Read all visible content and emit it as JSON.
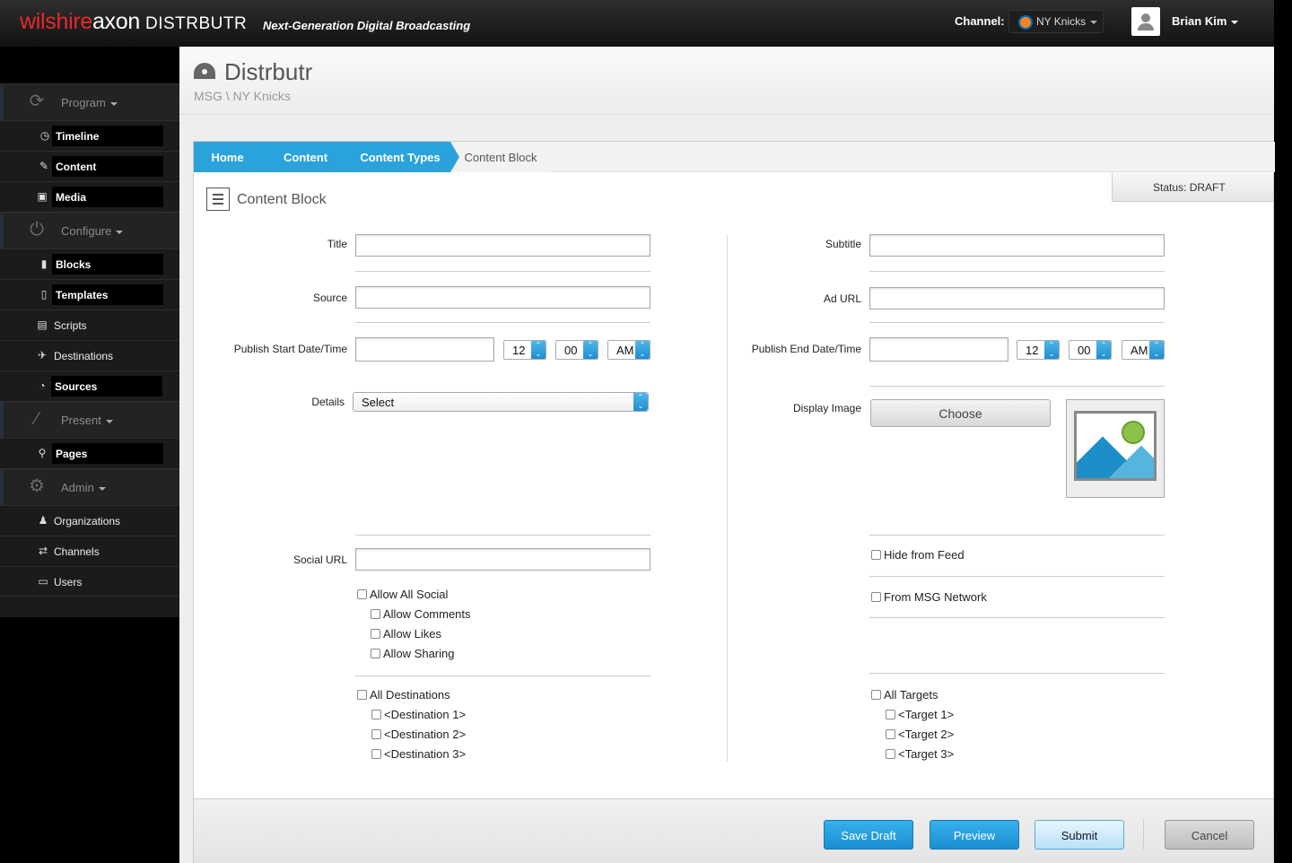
{
  "topbar": {
    "logo_part1": "wilshire",
    "logo_part2": "axon",
    "logo_part3": "DISTRBUTR",
    "tagline": "Next-Generation Digital Broadcasting",
    "channel_label": "Channel:",
    "channel_value": "NY Knicks",
    "user_name": "Brian Kim",
    "colors": {
      "logo_red": "#e8282e",
      "accent_blue": "#2aa3dd"
    }
  },
  "sidebar": {
    "program": {
      "label": "Program",
      "icon": "refresh-icon",
      "items": [
        {
          "label": "Timeline",
          "icon": "clock-icon"
        },
        {
          "label": "Content",
          "icon": "pencil-icon"
        },
        {
          "label": "Media",
          "icon": "picture-icon"
        }
      ]
    },
    "configure": {
      "label": "Configure",
      "icon": "power-icon",
      "items": [
        {
          "label": "Blocks",
          "icon": "bookmark-icon"
        },
        {
          "label": "Templates",
          "icon": "bookmark-outline-icon"
        },
        {
          "label": "Scripts",
          "icon": "script-icon"
        },
        {
          "label": "Destinations",
          "icon": "plane-icon"
        },
        {
          "label": "Sources",
          "icon": "rss-icon"
        }
      ]
    },
    "present": {
      "label": "Present",
      "icon": "magic-wand-icon",
      "items": [
        {
          "label": "Pages",
          "icon": "sitemap-icon"
        }
      ]
    },
    "admin": {
      "label": "Admin",
      "icon": "gear-icon",
      "items": [
        {
          "label": "Organizations",
          "icon": "group-icon"
        },
        {
          "label": "Channels",
          "icon": "exchange-icon"
        },
        {
          "label": "Users",
          "icon": "briefcase-icon"
        }
      ]
    }
  },
  "header": {
    "title": "Distrbutr",
    "subtitle": "MSG \\ NY Knicks"
  },
  "breadcrumbs": [
    "Home",
    "Content",
    "Content Types",
    "Content Block"
  ],
  "status": "Status: DRAFT",
  "block_title": "Content Block",
  "form": {
    "left": {
      "title_label": "Title",
      "source_label": "Source",
      "publish_start_label": "Publish Start Date/Time",
      "start_hour": "12",
      "start_minute": "00",
      "start_ampm": "AM",
      "details_label": "Details",
      "details_value": "Select",
      "social_url_label": "Social URL",
      "allow_all_social": "Allow All Social",
      "allow_comments": "Allow Comments",
      "allow_likes": "Allow Likes",
      "allow_sharing": "Allow Sharing",
      "all_destinations": "All Destinations",
      "destinations": [
        "<Destination 1>",
        "<Destination 2>",
        "<Destination 3>"
      ]
    },
    "right": {
      "subtitle_label": "Subtitle",
      "ad_url_label": "Ad URL",
      "publish_end_label": "Publish End Date/Time",
      "end_hour": "12",
      "end_minute": "00",
      "end_ampm": "AM",
      "display_image_label": "Display Image",
      "choose_label": "Choose",
      "hide_from_feed": "Hide from Feed",
      "from_msg_network": "From MSG Network",
      "all_targets": "All Targets",
      "targets": [
        "<Target 1>",
        "<Target 2>",
        "<Target 3>"
      ]
    }
  },
  "footer": {
    "save_draft": "Save Draft",
    "preview": "Preview",
    "submit": "Submit",
    "cancel": "Cancel"
  }
}
